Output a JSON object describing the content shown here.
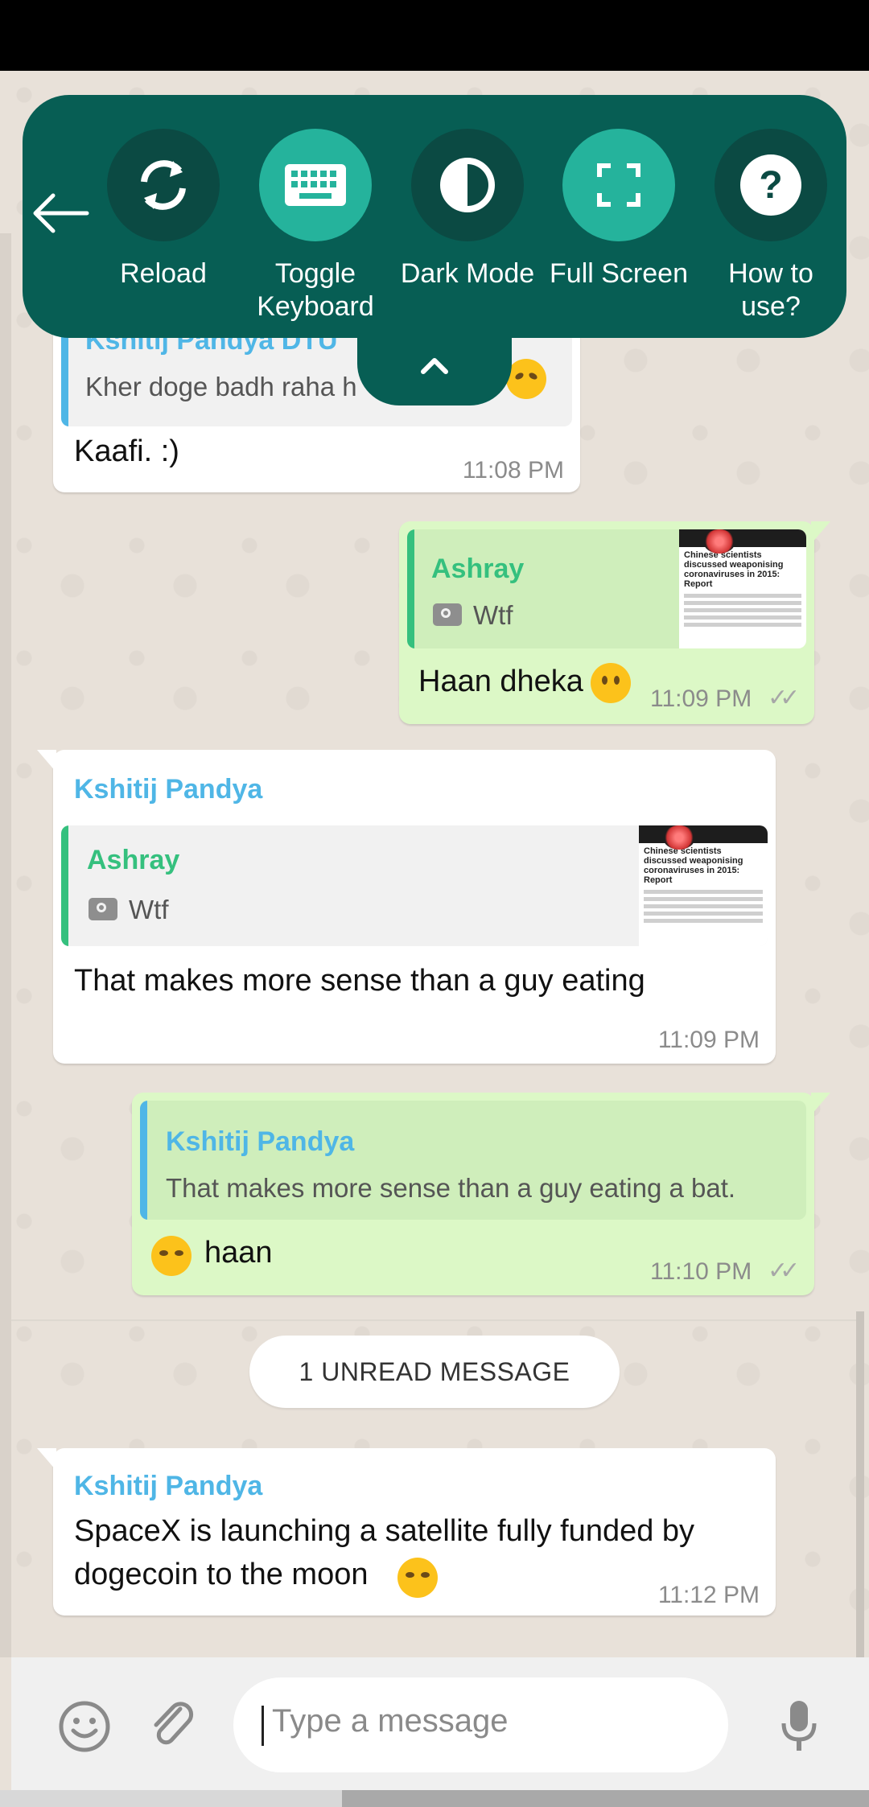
{
  "toolbar": {
    "back_icon": "arrow-left-icon",
    "buttons": [
      {
        "label": "Reload",
        "icon": "reload-icon"
      },
      {
        "label": "Toggle Keyboard",
        "icon": "keyboard-icon"
      },
      {
        "label": "Dark Mode",
        "icon": "dark-mode-icon"
      },
      {
        "label": "Full Screen",
        "icon": "fullscreen-icon"
      },
      {
        "label": "How to use?",
        "icon": "help-icon"
      }
    ],
    "collapse_icon": "chevron-up-icon",
    "colors": {
      "bar": "#075e54",
      "active": "#25b39c",
      "inactive": "#0b4a43"
    }
  },
  "messages": [
    {
      "direction": "incoming",
      "quote": {
        "sender": "Kshitij Pandya DTU",
        "text": "Kher doge badh raha h"
      },
      "text": "Kaafi. :)",
      "time": "11:08 PM"
    },
    {
      "direction": "outgoing",
      "quote": {
        "sender": "Ashray",
        "text": "Wtf",
        "thumb_title": "Chinese scientists discussed weaponising coronaviruses in 2015: Report"
      },
      "text": "Haan dheka",
      "time": "11:09 PM",
      "status": "read"
    },
    {
      "direction": "incoming",
      "sender": "Kshitij Pandya",
      "quote": {
        "sender": "Ashray",
        "text": "Wtf",
        "thumb_title": "Chinese scientists discussed weaponising coronaviruses in 2015: Report"
      },
      "text": "That makes more sense than a guy eating",
      "time": "11:09 PM"
    },
    {
      "direction": "outgoing",
      "quote": {
        "sender": "Kshitij Pandya",
        "text": "That makes more sense than a guy eating a bat."
      },
      "text": "haan",
      "time": "11:10 PM",
      "status": "read"
    },
    {
      "direction": "incoming",
      "sender": "Kshitij Pandya",
      "text_line1": "SpaceX is launching a satellite fully funded by",
      "text_line2": "dogecoin to the moon",
      "time": "11:12 PM"
    }
  ],
  "unread_banner": "1 UNREAD MESSAGE",
  "composer": {
    "placeholder": "Type a message",
    "emoji_icon": "smiley-icon",
    "attach_icon": "paperclip-icon",
    "mic_icon": "microphone-icon"
  },
  "colors": {
    "wallpaper": "#e8e1d9",
    "incoming_bubble": "#ffffff",
    "outgoing_bubble": "#dcf8c6",
    "sender_name": "#4fb6e6",
    "quote_name_green": "#35c07e"
  }
}
